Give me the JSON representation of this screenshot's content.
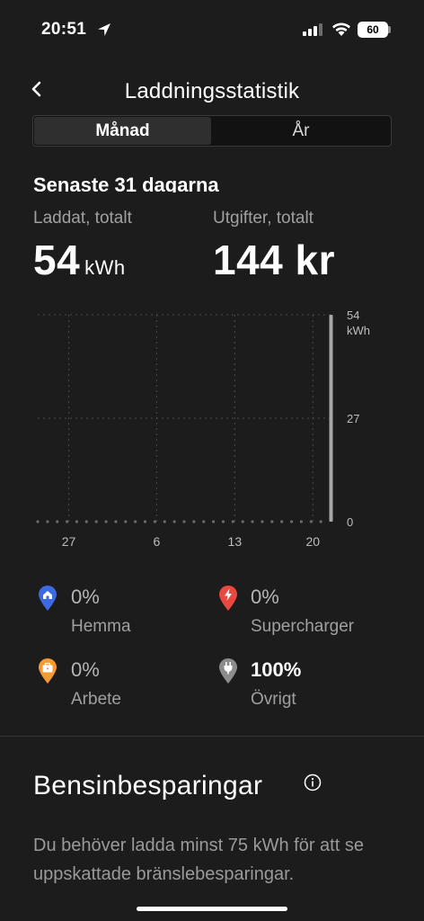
{
  "status_bar": {
    "time": "20:51",
    "battery": "60"
  },
  "header": {
    "title": "Laddningsstatistik"
  },
  "tabs": [
    {
      "label": "Månad",
      "selected": true
    },
    {
      "label": "År",
      "selected": false
    }
  ],
  "summary": {
    "period": "Senaste 31 dagarna",
    "charged_label": "Laddat, totalt",
    "charged_value": "54",
    "charged_unit": "kWh",
    "cost_label": "Utgifter, totalt",
    "cost_value": "144 kr"
  },
  "chart_data": {
    "type": "bar",
    "x_tick_labels": [
      "27",
      "6",
      "13",
      "20"
    ],
    "y_tick_labels": [
      "54",
      "27",
      "0"
    ],
    "y_unit": "kWh",
    "ylim": [
      0,
      54
    ],
    "values": [
      0,
      0,
      0,
      0,
      0,
      0,
      0,
      0,
      0,
      0,
      0,
      0,
      0,
      0,
      0,
      0,
      0,
      0,
      0,
      0,
      0,
      0,
      0,
      0,
      0,
      0,
      0,
      0,
      0,
      0,
      54
    ],
    "grid": true
  },
  "legend": [
    {
      "pct": "0%",
      "name": "Hemma",
      "icon": "home-icon",
      "color": "#3e6ae1"
    },
    {
      "pct": "0%",
      "name": "Supercharger",
      "icon": "bolt-icon",
      "color": "#e8483f"
    },
    {
      "pct": "0%",
      "name": "Arbete",
      "icon": "briefcase-icon",
      "color": "#f59a32"
    },
    {
      "pct": "100%",
      "name": "Övrigt",
      "icon": "plug-icon",
      "color": "#8c8c8c"
    }
  ],
  "savings": {
    "title": "Bensinbesparingar",
    "text": "Du behöver ladda minst 75 kWh för att se uppskattade bränslebesparingar."
  }
}
